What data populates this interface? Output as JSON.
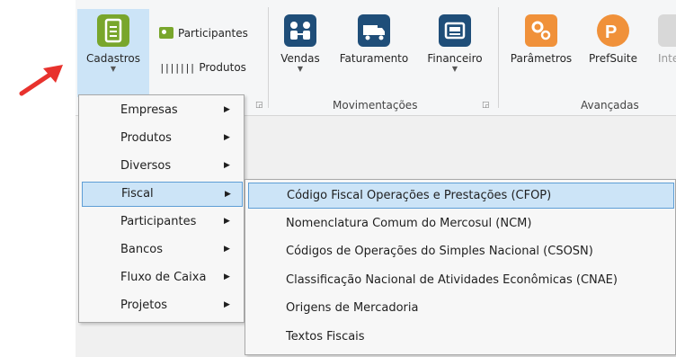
{
  "ribbon": {
    "cadastros": {
      "label": "Cadastros",
      "icon": "document-list-icon",
      "color": "#79a62c"
    },
    "participantes": {
      "label": "Participantes",
      "icon": "contact-card-icon",
      "color": "#79a62c"
    },
    "produtos": {
      "label": "Produtos",
      "icon": "barcode-icon"
    },
    "vendas": {
      "label": "Vendas",
      "icon": "people-exchange-icon",
      "color": "#1f4e79"
    },
    "faturamento": {
      "label": "Faturamento",
      "icon": "delivery-truck-icon",
      "color": "#1f4e79"
    },
    "financeiro": {
      "label": "Financeiro",
      "icon": "cash-register-icon",
      "color": "#1f4e79"
    },
    "parametros": {
      "label": "Parâmetros",
      "icon": "settings-gears-icon",
      "color": "#f0913a"
    },
    "prefsuite": {
      "label": "PrefSuite",
      "icon": "prefsuite-logo-icon",
      "color": "#f0913a"
    },
    "integracao": {
      "label": "Inte"
    },
    "groups": {
      "movimentacoes": "Movimentações",
      "avancadas": "Avançadas"
    }
  },
  "menu": {
    "items": [
      {
        "label": "Empresas"
      },
      {
        "label": "Produtos"
      },
      {
        "label": "Diversos"
      },
      {
        "label": "Fiscal",
        "highlighted": true
      },
      {
        "label": "Participantes"
      },
      {
        "label": "Bancos"
      },
      {
        "label": "Fluxo de Caixa"
      },
      {
        "label": "Projetos"
      }
    ]
  },
  "submenu": {
    "items": [
      {
        "label": "Código Fiscal Operações e Prestações (CFOP)",
        "highlighted": true
      },
      {
        "label": "Nomenclatura Comum do Mercosul (NCM)"
      },
      {
        "label": "Códigos de Operações do Simples Nacional (CSOSN)"
      },
      {
        "label": "Classificação Nacional de Atividades Econômicas (CNAE)"
      },
      {
        "label": "Origens de Mercadoria"
      },
      {
        "label": "Textos Fiscais"
      }
    ]
  },
  "annotation": {
    "icon": "red-arrow-icon",
    "color": "#e8322d"
  },
  "colors": {
    "highlight": "#cce4f7",
    "highlight_border": "#5e9ed6"
  }
}
